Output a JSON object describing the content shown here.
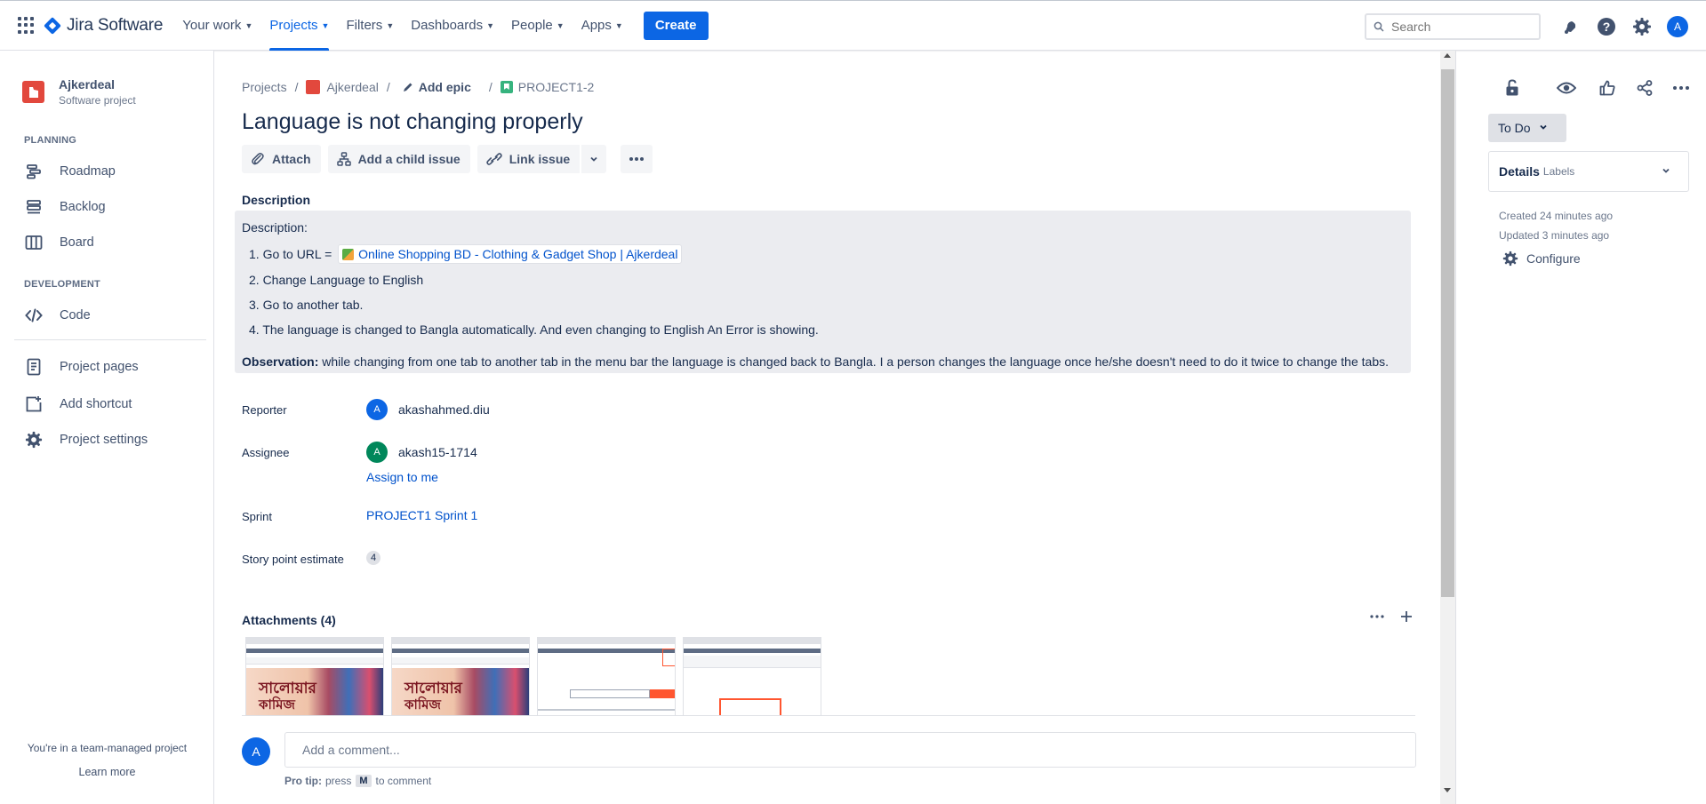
{
  "nav": {
    "logo_text": "Jira Software",
    "items": [
      {
        "label": "Your work",
        "active": false
      },
      {
        "label": "Projects",
        "active": true
      },
      {
        "label": "Filters",
        "active": false
      },
      {
        "label": "Dashboards",
        "active": false
      },
      {
        "label": "People",
        "active": false
      },
      {
        "label": "Apps",
        "active": false
      }
    ],
    "create_label": "Create",
    "search_placeholder": "Search",
    "user_initial": "A"
  },
  "sidebar": {
    "project_name": "Ajkerdeal",
    "project_type": "Software project",
    "planning_heading": "PLANNING",
    "planning_items": [
      "Roadmap",
      "Backlog",
      "Board"
    ],
    "development_heading": "DEVELOPMENT",
    "development_items": [
      "Code"
    ],
    "other_items": [
      "Project pages",
      "Add shortcut",
      "Project settings"
    ],
    "team_note": "You're in a team-managed project",
    "learn_more": "Learn more"
  },
  "breadcrumb": {
    "projects": "Projects",
    "project": "Ajkerdeal",
    "add_epic": "Add epic",
    "issue_key": "PROJECT1-2"
  },
  "issue": {
    "title": "Language is not changing properly",
    "toolbar": {
      "attach": "Attach",
      "add_child": "Add a child issue",
      "link_issue": "Link issue"
    },
    "description_label": "Description",
    "description": {
      "intro": "Description:",
      "step1_prefix": "1. Go to URL = ",
      "step1_link": "Online Shopping BD - Clothing & Gadget Shop | Ajkerdeal",
      "step2": "2. Change Language to English",
      "step3": "3. Go to another tab.",
      "step4": "4. The language is changed to Bangla automatically. And even changing to English An Error is showing.",
      "observation_label": "Observation:",
      "observation_text": " while changing from one tab to another tab in the menu bar the language is changed back to Bangla. I a person changes the language once he/she doesn't need to do it twice to change the tabs."
    },
    "fields": {
      "reporter_label": "Reporter",
      "reporter_name": "akashahmed.diu",
      "reporter_initial": "A",
      "assignee_label": "Assignee",
      "assignee_name": "akash15-1714",
      "assignee_initial": "A",
      "assign_to_me": "Assign to me",
      "sprint_label": "Sprint",
      "sprint_value": "PROJECT1 Sprint 1",
      "story_label": "Story point estimate",
      "story_value": "4"
    },
    "attachments_label": "Attachments (4)",
    "thumbnails": [
      {
        "banner_line1": "সালোয়ার",
        "banner_line2": "কামিজ"
      },
      {
        "banner_line1": "সালোয়ার",
        "banner_line2": "কামিজ"
      }
    ],
    "comment": {
      "user_initial": "A",
      "placeholder": "Add a comment...",
      "pro_tip_label": "Pro tip:",
      "pro_tip_text": "press",
      "pro_tip_key": "M",
      "pro_tip_suffix": "to comment"
    }
  },
  "right_panel": {
    "status": "To Do",
    "details_title": "Details",
    "details_sub": "Labels",
    "created": "Created 24 minutes ago",
    "updated": "Updated 3 minutes ago",
    "configure": "Configure"
  },
  "colors": {
    "accent": "#0c66e4",
    "project_icon": "#e2483d",
    "assignee_avatar": "#00875a"
  }
}
